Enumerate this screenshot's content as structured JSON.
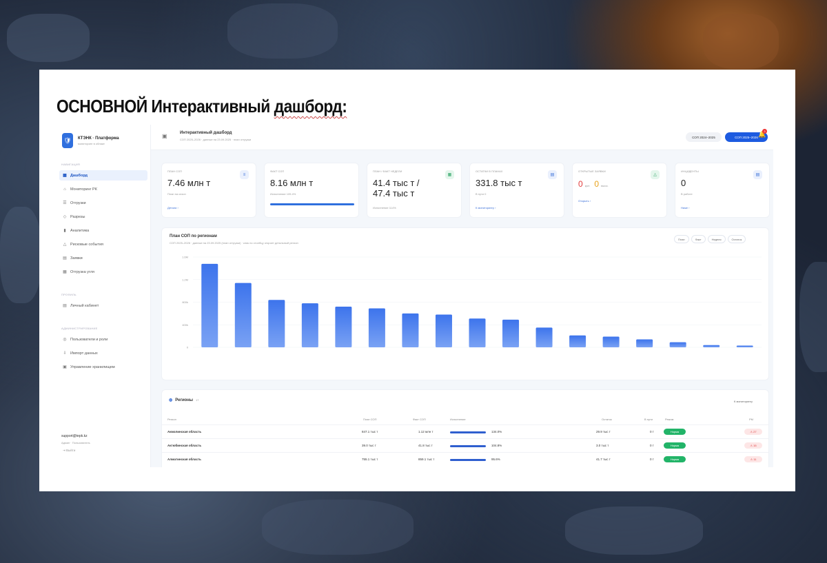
{
  "slide": {
    "title_main": "ОСНОВНОЙ Интерактивный ",
    "title_underlined": "дашборд:"
  },
  "brand": {
    "logo_icon": "🛡",
    "name": "КТЭНК · Платформа",
    "subtitle": "мониторинг в облаке"
  },
  "sidebar": {
    "section_main": "НАВИГАЦИЯ",
    "items": [
      {
        "label": "Дашборд",
        "icon": "▦"
      },
      {
        "label": "Мониторинг РК",
        "icon": "⌂"
      },
      {
        "label": "Отгрузки",
        "icon": "☰"
      },
      {
        "label": "Разрезы",
        "icon": "◇"
      },
      {
        "label": "Аналитика",
        "icon": "▮"
      },
      {
        "label": "Рисковые события",
        "icon": "△"
      },
      {
        "label": "Заявки",
        "icon": "▤"
      },
      {
        "label": "Отгрузка угля",
        "icon": "▦"
      }
    ],
    "section_profile": "ПРОФИЛЬ",
    "profile_items": [
      {
        "label": "Личный кабинет",
        "icon": "▤"
      }
    ],
    "section_admin": "АДМИНИСТРИРОВАНИЕ",
    "admin_items": [
      {
        "label": "Пользователи и роли",
        "icon": "◎"
      },
      {
        "label": "Импорт данных",
        "icon": "⇩"
      },
      {
        "label": "Управление хранилищем",
        "icon": "▣"
      }
    ],
    "footer": {
      "email": "support@tepk.kz",
      "role": "Админ · Пользователь",
      "logout": "Выйти"
    }
  },
  "header": {
    "title": "Интерактивный дашборд",
    "subtitle": "СОП 2025–2026 · данные на 23.09.2025 · план отгрузки",
    "period_a": "СОП 2024–2025",
    "period_b": "СОП 2025–2026",
    "notif_count": "3"
  },
  "kpis": [
    {
      "label": "ПЛАН СОП",
      "value": "7.46 млн т",
      "sub": "План на сезон",
      "link": "Детали ›",
      "icon": "≡",
      "icon_bg": "#eaf0fd",
      "icon_color": "#3a6fd8"
    },
    {
      "label": "ФАКТ СОП",
      "value": "8.16 млн т",
      "sub": "Исполнение 109.4%",
      "link": "",
      "icon": "",
      "progress": 1.0
    },
    {
      "label": "ПЛАН / ФАКТ НЕДЕЛИ",
      "value": "41.4 тыс т /",
      "value2": "47.4 тыс т",
      "sub": "Исполнение 114%",
      "icon": "▦",
      "icon_bg": "#e4f6ec",
      "icon_color": "#2aa262"
    },
    {
      "label": "ОСТАТКИ В ПЛАНАХ",
      "value": "331.8 тыс т",
      "sub": "В пути 0",
      "link": "К мониторингу ›",
      "icon": "▤",
      "icon_bg": "#eaf0fd",
      "icon_color": "#3a6fd8"
    },
    {
      "label": "ОТКРЫТЫЕ ЗАЯВКИ",
      "crit_value": "0",
      "crit_label": "крит.",
      "warn_value": "0",
      "warn_label": "высок.",
      "link": "Открыть ›",
      "icon": "△",
      "icon_bg": "#e4f6ec",
      "icon_color": "#2aa262"
    },
    {
      "label": "ИНЦИДЕНТЫ",
      "value": "0",
      "sub": "В работе",
      "link": "Ниже ›",
      "icon": "▤",
      "icon_bg": "#eaf0fd",
      "icon_color": "#3a6fd8"
    }
  ],
  "chart_panel": {
    "title": "План СОП по регионам",
    "subtitle": "СОП 2025–2026 · данные на 23.09.2025 (план отгрузки) · клик по столбцу откроет детальный регион",
    "tabs": [
      "План",
      "Факт",
      "Неделя",
      "Остаток"
    ]
  },
  "chart_data": {
    "type": "bar",
    "title": "План СОП по регионам",
    "y_ticks": [
      "1.6M",
      "1.2M",
      "800k",
      "400k",
      "0"
    ],
    "ylim": [
      0,
      1600000
    ],
    "values": [
      1480000,
      1140000,
      840000,
      780000,
      720000,
      690000,
      600000,
      580000,
      510000,
      490000,
      350000,
      210000,
      190000,
      140000,
      90000,
      40000,
      30000
    ],
    "bar_color": "#3d74ec"
  },
  "table": {
    "title": "Регионы",
    "count": "17",
    "link": "К мониторингу",
    "headers": {
      "region": "Регион",
      "plan": "План СОП",
      "fact": "Факт СОП",
      "exec": "Исполнение",
      "rest": "Остаток",
      "way": "В пути",
      "mode": "Режим",
      "rm": "РМ"
    },
    "rows": [
      {
        "region": "Акмолинская область",
        "plan": "847.1 тыс т",
        "fact": "1.12 млн т",
        "pct": "134.0%",
        "rest": "29.9 тыс т",
        "way": "0 т",
        "mode": "Норма",
        "rm": "⚠ 27"
      },
      {
        "region": "Актюбинская область",
        "plan": "39.0 тыс т",
        "fact": "41.8 тыс т",
        "pct": "104.8%",
        "rest": "3.0 тыс т",
        "way": "0 т",
        "mode": "Норма",
        "rm": "⚠ 15"
      },
      {
        "region": "Алматинская область",
        "plan": "755.1 тыс т",
        "fact": "859.1 тыс т",
        "pct": "95.6%",
        "rest": "41.7 тыс т",
        "way": "0 т",
        "mode": "Норма",
        "rm": "⚠ 11"
      }
    ]
  }
}
